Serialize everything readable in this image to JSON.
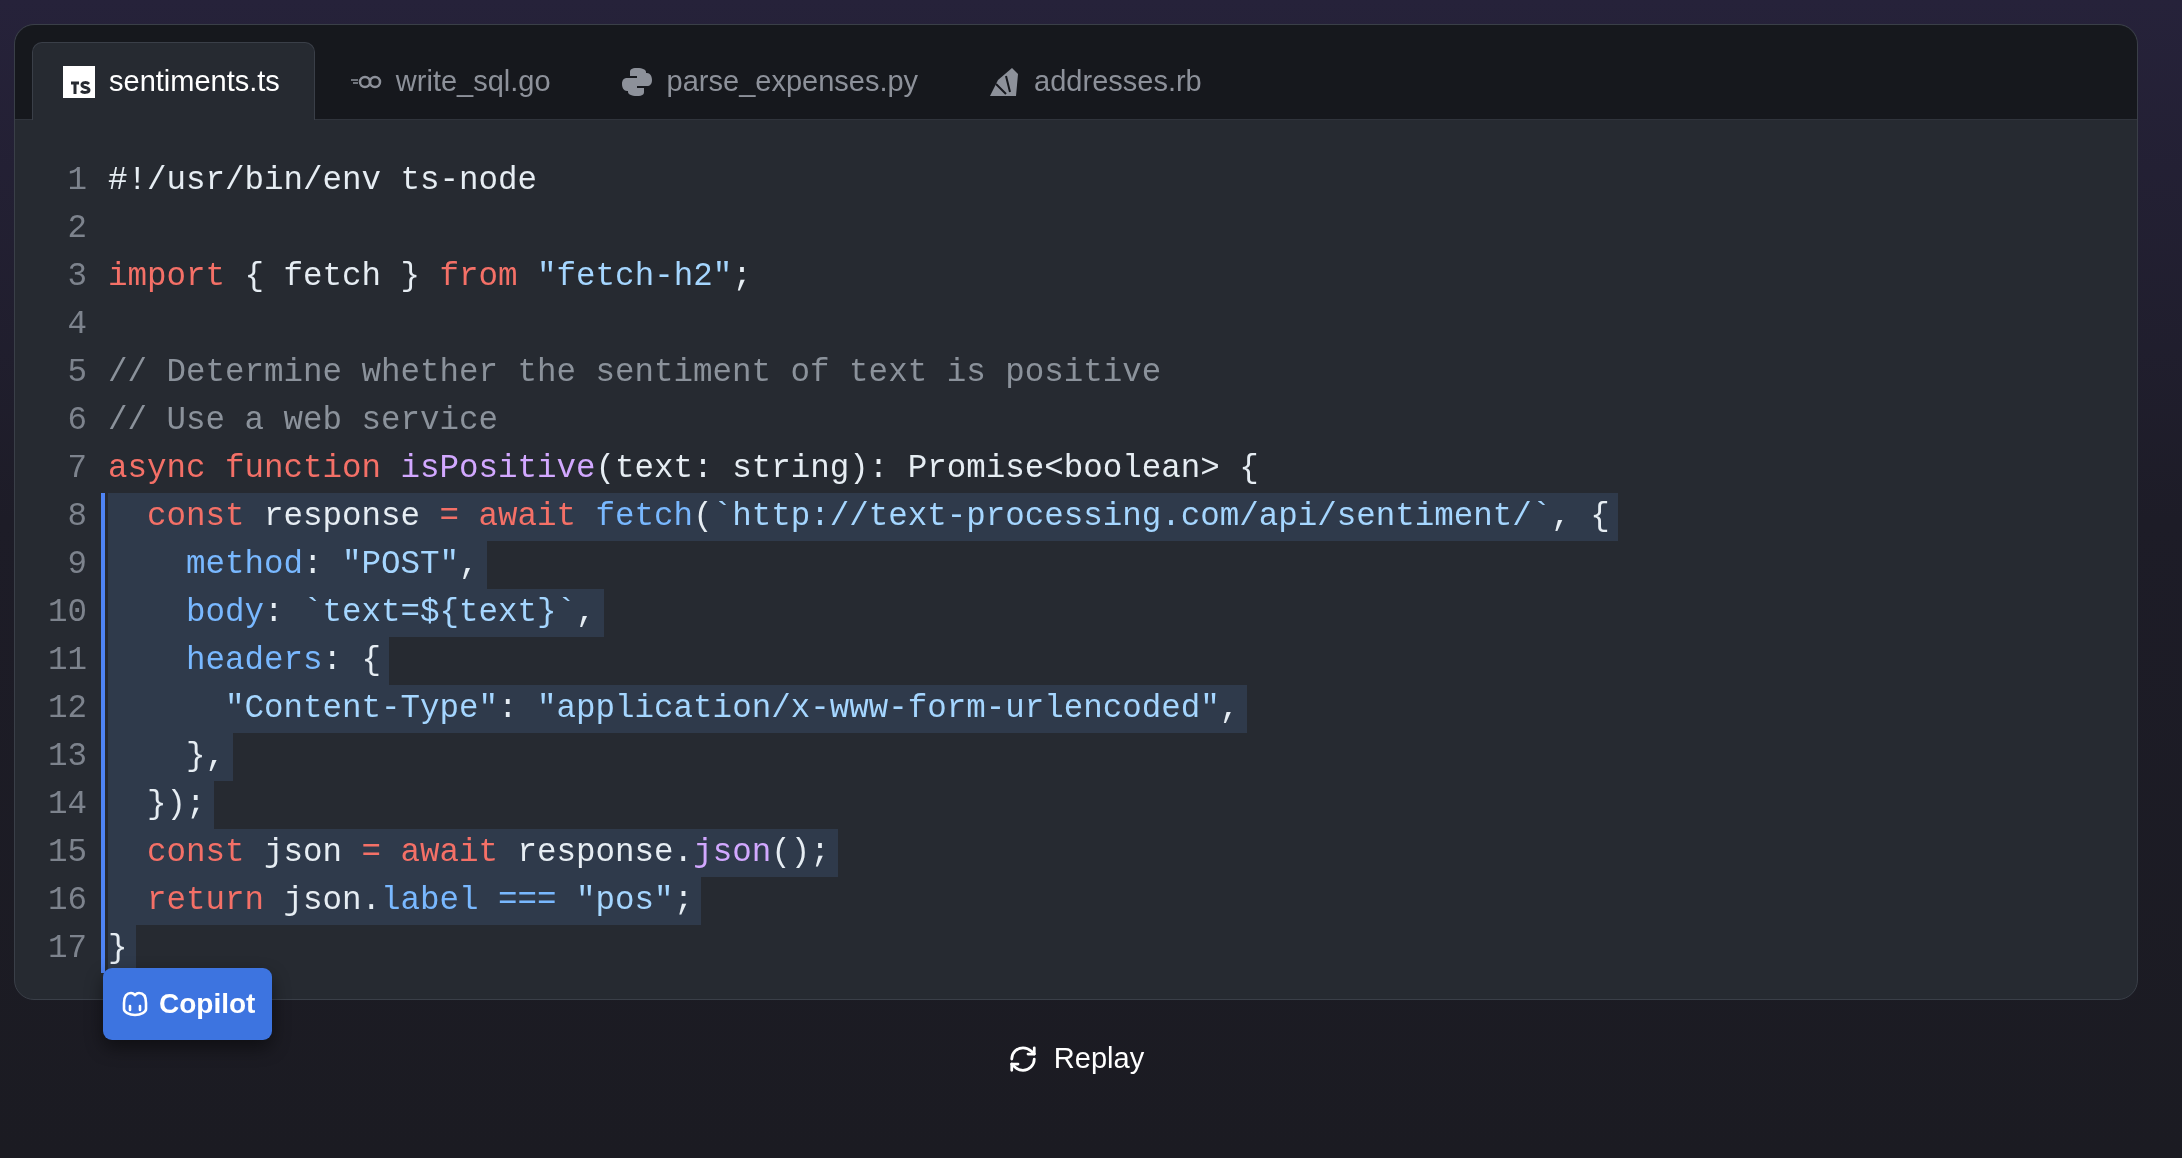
{
  "tabs": [
    {
      "label": "sentiments.ts",
      "kind": "typescript",
      "selected": true
    },
    {
      "label": "write_sql.go",
      "kind": "go",
      "selected": false
    },
    {
      "label": "parse_expenses.py",
      "kind": "python",
      "selected": false
    },
    {
      "label": "addresses.rb",
      "kind": "ruby",
      "selected": false
    }
  ],
  "lines": [
    {
      "number": "1",
      "suggested": false,
      "tokens": [
        {
          "kind": "plain",
          "text": "#!/usr/bin/env ts-node"
        }
      ]
    },
    {
      "number": "2",
      "suggested": false
    },
    {
      "number": "3",
      "suggested": false,
      "tokens": [
        {
          "kind": "kw",
          "text": "import"
        },
        {
          "kind": "plain",
          "text": " { fetch } "
        },
        {
          "kind": "kw",
          "text": "from "
        },
        {
          "kind": "str",
          "text": "\"fetch-h2\""
        },
        {
          "kind": "plain",
          "text": ";"
        }
      ]
    },
    {
      "number": "4",
      "suggested": false
    },
    {
      "number": "5",
      "suggested": false,
      "tokens": [
        {
          "kind": "cmt",
          "text": "// Determine whether the sentiment of text is positive"
        }
      ]
    },
    {
      "number": "6",
      "suggested": false,
      "tokens": [
        {
          "kind": "cmt",
          "text": "// Use a web service"
        }
      ]
    },
    {
      "number": "7",
      "suggested": false,
      "tokens": [
        {
          "kind": "kw",
          "text": "async function "
        },
        {
          "kind": "fn",
          "text": "isPositive"
        },
        {
          "kind": "plain",
          "text": "(text: string): Promise<boolean> {"
        }
      ]
    },
    {
      "number": "8",
      "suggested": true,
      "tokens": [
        {
          "kind": "kw",
          "text": "  const"
        },
        {
          "kind": "plain",
          "text": " response "
        },
        {
          "kind": "kw",
          "text": "= await "
        },
        {
          "kind": "prop",
          "text": "fetch"
        },
        {
          "kind": "plain",
          "text": "("
        },
        {
          "kind": "str",
          "text": "`http://text-processing.com/api/sentiment/`"
        },
        {
          "kind": "plain",
          "text": ", {"
        }
      ]
    },
    {
      "number": "9",
      "suggested": true,
      "tokens": [
        {
          "kind": "prop",
          "text": "    method"
        },
        {
          "kind": "plain",
          "text": ": "
        },
        {
          "kind": "str",
          "text": "\"POST\""
        },
        {
          "kind": "plain",
          "text": ","
        }
      ]
    },
    {
      "number": "10",
      "suggested": true,
      "tokens": [
        {
          "kind": "prop",
          "text": "    body"
        },
        {
          "kind": "plain",
          "text": ": "
        },
        {
          "kind": "str",
          "text": "`text=${text}`"
        },
        {
          "kind": "plain",
          "text": ","
        }
      ]
    },
    {
      "number": "11",
      "suggested": true,
      "tokens": [
        {
          "kind": "prop",
          "text": "    headers"
        },
        {
          "kind": "plain",
          "text": ": {"
        }
      ]
    },
    {
      "number": "12",
      "suggested": true,
      "tokens": [
        {
          "kind": "str",
          "text": "      \"Content-Type\""
        },
        {
          "kind": "plain",
          "text": ": "
        },
        {
          "kind": "str",
          "text": "\"application/x-www-form-urlencoded\""
        },
        {
          "kind": "plain",
          "text": ","
        }
      ]
    },
    {
      "number": "13",
      "suggested": true,
      "tokens": [
        {
          "kind": "plain",
          "text": "    },"
        }
      ]
    },
    {
      "number": "14",
      "suggested": true,
      "tokens": [
        {
          "kind": "plain",
          "text": "  });"
        }
      ]
    },
    {
      "number": "15",
      "suggested": true,
      "tokens": [
        {
          "kind": "kw",
          "text": "  const"
        },
        {
          "kind": "plain",
          "text": " json "
        },
        {
          "kind": "kw",
          "text": "= await"
        },
        {
          "kind": "plain",
          "text": " response."
        },
        {
          "kind": "fn",
          "text": "json"
        },
        {
          "kind": "plain",
          "text": "();"
        }
      ]
    },
    {
      "number": "16",
      "suggested": true,
      "tokens": [
        {
          "kind": "kw",
          "text": "  return"
        },
        {
          "kind": "plain",
          "text": " json."
        },
        {
          "kind": "prop",
          "text": "label ==="
        },
        {
          "kind": "str",
          "text": " \"pos\""
        },
        {
          "kind": "plain",
          "text": ";"
        }
      ]
    },
    {
      "number": "17",
      "suggested": true,
      "tokens": [
        {
          "kind": "plain",
          "text": "}"
        }
      ]
    }
  ],
  "copilot_badge": {
    "label": "Copilot"
  },
  "replay_button": {
    "label": "Replay"
  }
}
